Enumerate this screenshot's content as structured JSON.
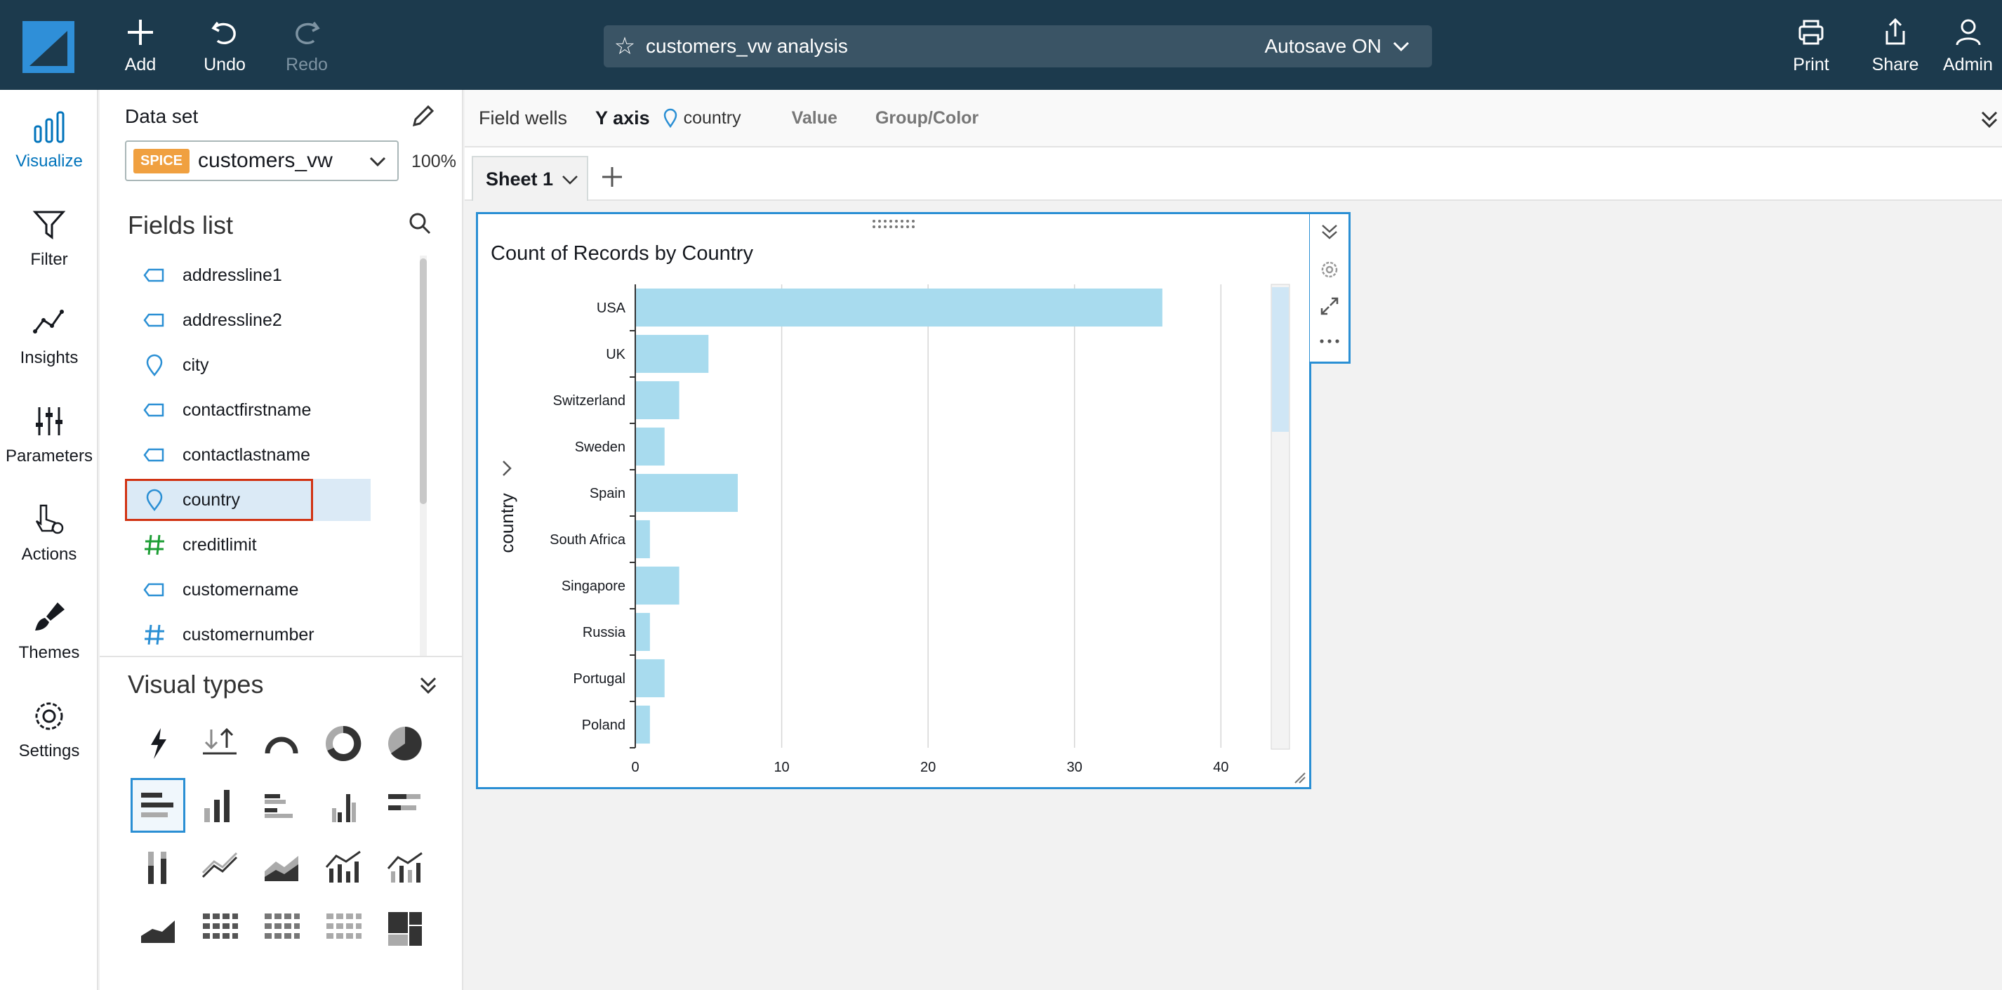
{
  "toolbar": {
    "add_label": "Add",
    "undo_label": "Undo",
    "redo_label": "Redo",
    "analysis_title": "customers_vw analysis",
    "autosave_label": "Autosave ON",
    "print_label": "Print",
    "share_label": "Share",
    "admin_label": "Admin"
  },
  "nav": {
    "visualize": "Visualize",
    "filter": "Filter",
    "insights": "Insights",
    "parameters": "Parameters",
    "actions": "Actions",
    "themes": "Themes",
    "settings": "Settings"
  },
  "dataset": {
    "label": "Data set",
    "badge": "SPICE",
    "name": "customers_vw",
    "percent": "100%"
  },
  "fields_list": {
    "title": "Fields list",
    "items": [
      {
        "name": "addressline1",
        "type": "text"
      },
      {
        "name": "addressline2",
        "type": "text"
      },
      {
        "name": "city",
        "type": "geo"
      },
      {
        "name": "contactfirstname",
        "type": "text"
      },
      {
        "name": "contactlastname",
        "type": "text"
      },
      {
        "name": "country",
        "type": "geo"
      },
      {
        "name": "creditlimit",
        "type": "measure"
      },
      {
        "name": "customername",
        "type": "text"
      },
      {
        "name": "customernumber",
        "type": "number"
      }
    ]
  },
  "visual_types": {
    "title": "Visual types"
  },
  "field_wells": {
    "label": "Field wells",
    "y_axis_label": "Y axis",
    "y_axis_value": "country",
    "value_label": "Value",
    "group_label": "Group/Color"
  },
  "sheet": {
    "tab_label": "Sheet 1"
  },
  "visual": {
    "title": "Count of Records by Country"
  },
  "colors": {
    "bar": "#a8dbee",
    "accent": "#2a8fd4",
    "topbar": "#1c3a4d"
  },
  "chart_data": {
    "type": "bar",
    "orientation": "horizontal",
    "categories": [
      "USA",
      "UK",
      "Switzerland",
      "Sweden",
      "Spain",
      "South Africa",
      "Singapore",
      "Russia",
      "Portugal",
      "Poland"
    ],
    "values": [
      36,
      5,
      3,
      2,
      7,
      1,
      3,
      1,
      2,
      1
    ],
    "ylabel": "country",
    "xlim": [
      0,
      42
    ],
    "xticks": [
      0,
      10,
      20,
      30,
      40
    ],
    "grid": true
  }
}
